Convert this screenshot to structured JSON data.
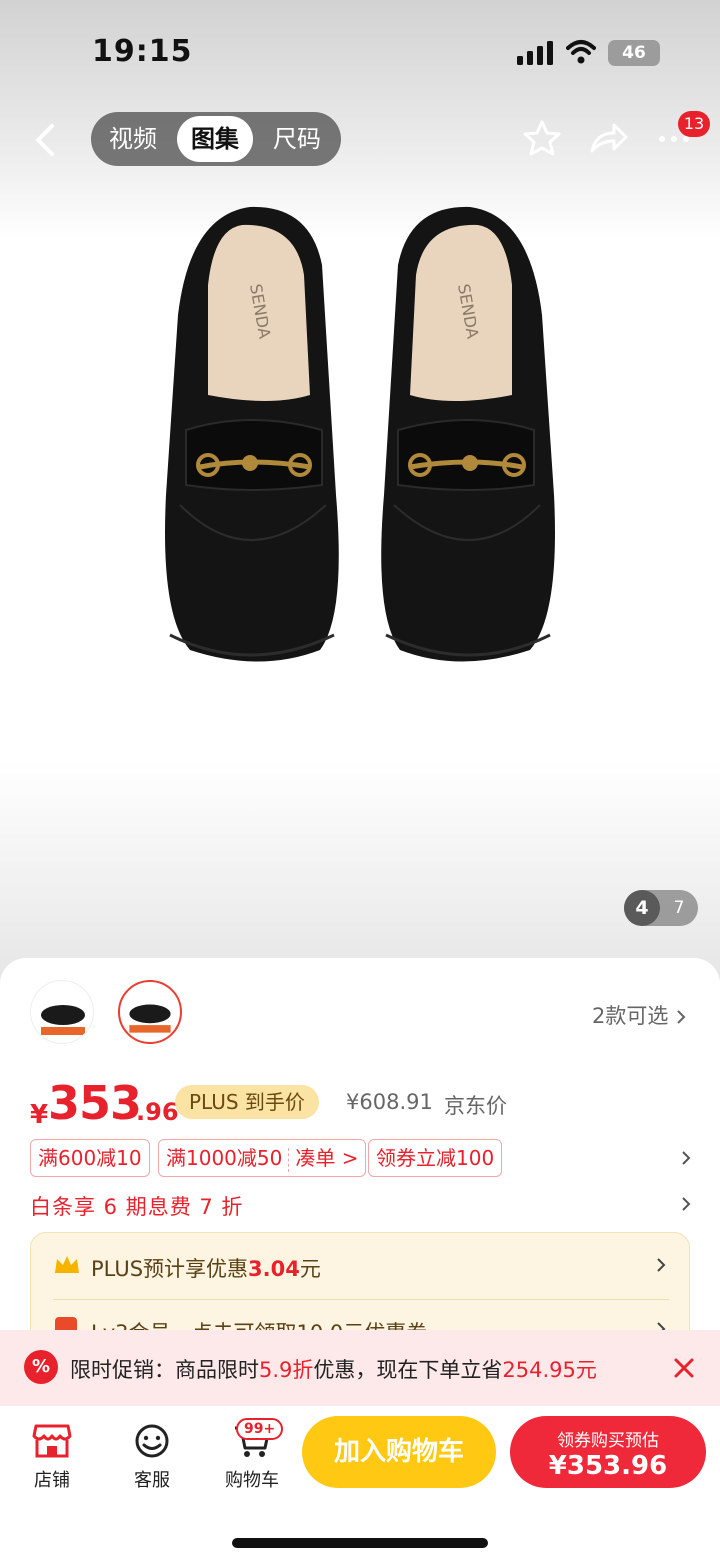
{
  "status_bar": {
    "time": "19:15",
    "network": "46"
  },
  "top_nav": {
    "tabs": [
      {
        "label": "视频",
        "active": false
      },
      {
        "label": "图集",
        "active": true
      },
      {
        "label": "尺码",
        "active": false
      }
    ],
    "notification_count": "13"
  },
  "gallery": {
    "brand_on_insole": "SENDA",
    "current_page": "4",
    "total_pages": "7"
  },
  "product": {
    "variants_label": "2款可选",
    "price_symbol": "¥",
    "price_main": "353",
    "price_decimal": ".96",
    "plus_tag": "PLUS 到手价",
    "jd_price": "¥608.91",
    "jd_price_label": "京东价",
    "coupons": [
      {
        "label": "满600减10"
      },
      {
        "label": "满1000减50",
        "extra": "凑单 >"
      },
      {
        "label": "领券立减100"
      }
    ],
    "baitiao": "白条享 6 期息费 7 折",
    "plus_benefit": {
      "prefix": "PLUS预计享优惠",
      "amount": "3.04",
      "suffix": "元"
    },
    "member_benefit": "Lv3会员，点击可领取10.0元优惠券"
  },
  "promo_banner": {
    "icon_text": "%",
    "prefix": "限时促销：商品限时",
    "discount": "5.9折",
    "middle": "优惠，现在下单立省",
    "saving": "254.95元"
  },
  "bottom_bar": {
    "shop_label": "店铺",
    "service_label": "客服",
    "cart_label": "购物车",
    "cart_badge": "99+",
    "add_to_cart": "加入购物车",
    "buy_line1": "领券购买预估",
    "buy_line2": "¥353.96"
  },
  "colors": {
    "accent_red": "#e8222c",
    "add_cart_yellow": "#ffc812",
    "buy_red": "#f0293a",
    "plus_gold": "#fbe3a3"
  }
}
